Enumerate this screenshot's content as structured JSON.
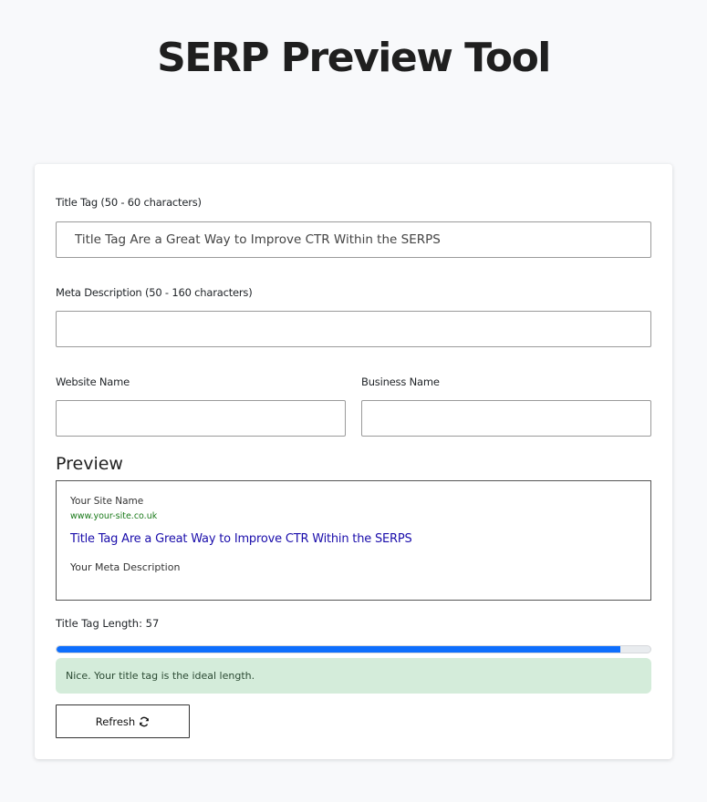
{
  "page": {
    "title": "SERP Preview Tool"
  },
  "form": {
    "title_tag": {
      "label": "Title Tag (50 - 60 characters)",
      "value": "Title Tag Are a Great Way to Improve CTR Within the SERPS",
      "placeholder": ""
    },
    "meta_description": {
      "label": "Meta Description (50 - 160 characters)",
      "value": "",
      "placeholder": ""
    },
    "website_name": {
      "label": "Website Name",
      "value": "",
      "placeholder": ""
    },
    "business_name": {
      "label": "Business Name",
      "value": "",
      "placeholder": ""
    }
  },
  "preview": {
    "heading": "Preview",
    "site_name": "Your Site Name",
    "url": "www.your-site.co.uk",
    "title": "Title Tag Are a Great Way to Improve CTR Within the SERPS",
    "description": "Your Meta Description"
  },
  "length": {
    "label": "Title Tag Length:",
    "value": "57",
    "progress_fraction": 0.95,
    "bar_color": "#0d6efd",
    "message": "Nice. Your title tag is the ideal length."
  },
  "actions": {
    "refresh_label": "Refresh",
    "refresh_icon": "refresh-icon"
  }
}
